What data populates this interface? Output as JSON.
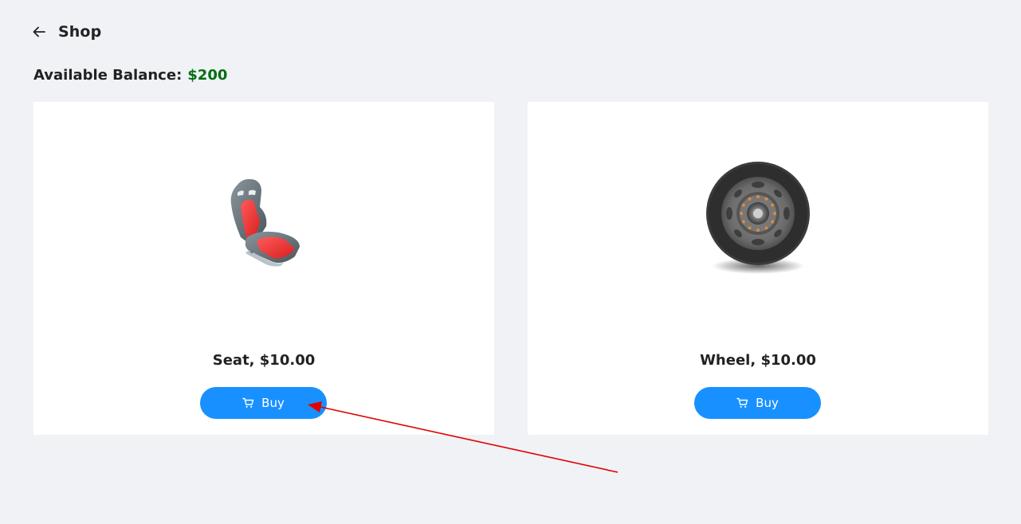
{
  "header": {
    "title": "Shop",
    "back_icon": "arrow-left-icon"
  },
  "balance": {
    "label": "Available Balance",
    "separator": ":",
    "value": "$200",
    "value_color": "#006e13"
  },
  "products": [
    {
      "name": "Seat, $10.00",
      "image_icon": "car-seat-image",
      "button_label": "Buy",
      "button_icon": "shopping-cart-icon"
    },
    {
      "name": "Wheel, $10.00",
      "image_icon": "wheel-image",
      "button_label": "Buy",
      "button_icon": "shopping-cart-icon"
    }
  ],
  "colors": {
    "background": "#f0f2f5",
    "card": "#ffffff",
    "accent": "#1890ff",
    "annotation_arrow": "#e00000"
  }
}
